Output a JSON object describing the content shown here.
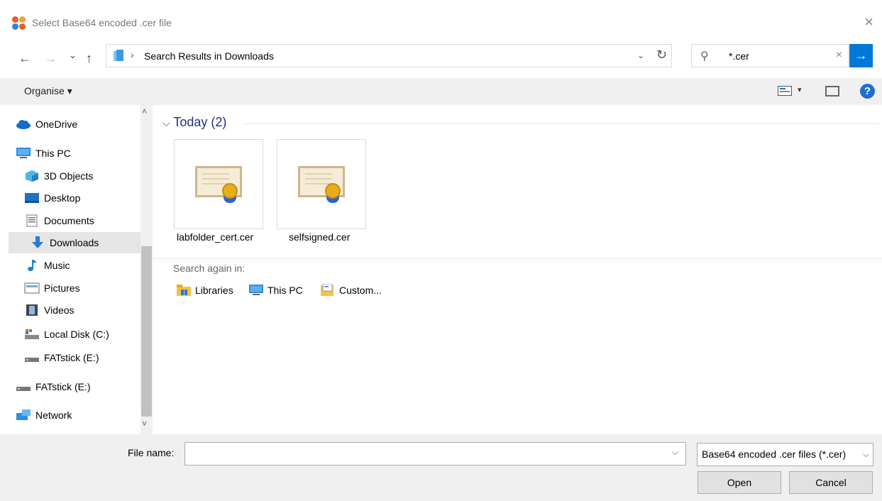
{
  "window": {
    "title": "Select Base64 encoded .cer file",
    "close_label": "×"
  },
  "nav_buttons": {
    "back": "←",
    "forward": "→",
    "recent": "⌄",
    "up": "↑"
  },
  "address": {
    "separator": "›",
    "path": "Search Results in Downloads",
    "dropdown": "⌄",
    "refresh": "↻"
  },
  "search": {
    "value": "*.cer",
    "clear": "×",
    "go": "→"
  },
  "toolbar": {
    "organise_label": "Organise ▾",
    "view_dropdown": "▾",
    "help_label": "?"
  },
  "nav_pane": {
    "items": [
      {
        "label": "OneDrive",
        "icon": "cloud-icon"
      },
      {
        "label": "This PC",
        "icon": "computer-icon"
      },
      {
        "label": "3D Objects",
        "icon": "cube-icon"
      },
      {
        "label": "Desktop",
        "icon": "desktop-icon"
      },
      {
        "label": "Documents",
        "icon": "document-icon"
      },
      {
        "label": "Downloads",
        "icon": "download-icon",
        "state": "hovered"
      },
      {
        "label": "Music",
        "icon": "music-icon"
      },
      {
        "label": "Pictures",
        "icon": "pictures-icon"
      },
      {
        "label": "Videos",
        "icon": "videos-icon"
      },
      {
        "label": "Local Disk (C:)",
        "icon": "drive-icon"
      },
      {
        "label": "FATstick (E:)",
        "icon": "usb-drive-icon"
      },
      {
        "label": "FATstick (E:)",
        "icon": "usb-drive-icon"
      },
      {
        "label": "Network",
        "icon": "network-icon"
      }
    ],
    "scroll_up": "˄",
    "scroll_down": "˅"
  },
  "content": {
    "group_header": "Today (2)",
    "group_chevron": "⌵",
    "files": [
      {
        "name": "labfolder_cert.cer",
        "icon": "certificate-icon"
      },
      {
        "name": "selfsigned.cer",
        "icon": "certificate-icon"
      }
    ],
    "search_again_label": "Search again in:",
    "search_again_items": [
      {
        "label": "Libraries",
        "icon": "libraries-icon"
      },
      {
        "label": "This PC",
        "icon": "computer-icon"
      },
      {
        "label": "Custom...",
        "icon": "custom-folder-icon"
      }
    ]
  },
  "bottom": {
    "file_name_label": "File name:",
    "file_name_value": "",
    "file_name_dropdown": "⌵",
    "filter_value": "Base64 encoded .cer files (*.cer)",
    "filter_dropdown": "⌵",
    "open_label": "Open",
    "cancel_label": "Cancel"
  },
  "colors": {
    "accent": "#0078d7",
    "header_blue": "#1e3287",
    "toolbar_bg": "#f0f0f0",
    "hover_bg": "#e5e5e5"
  }
}
